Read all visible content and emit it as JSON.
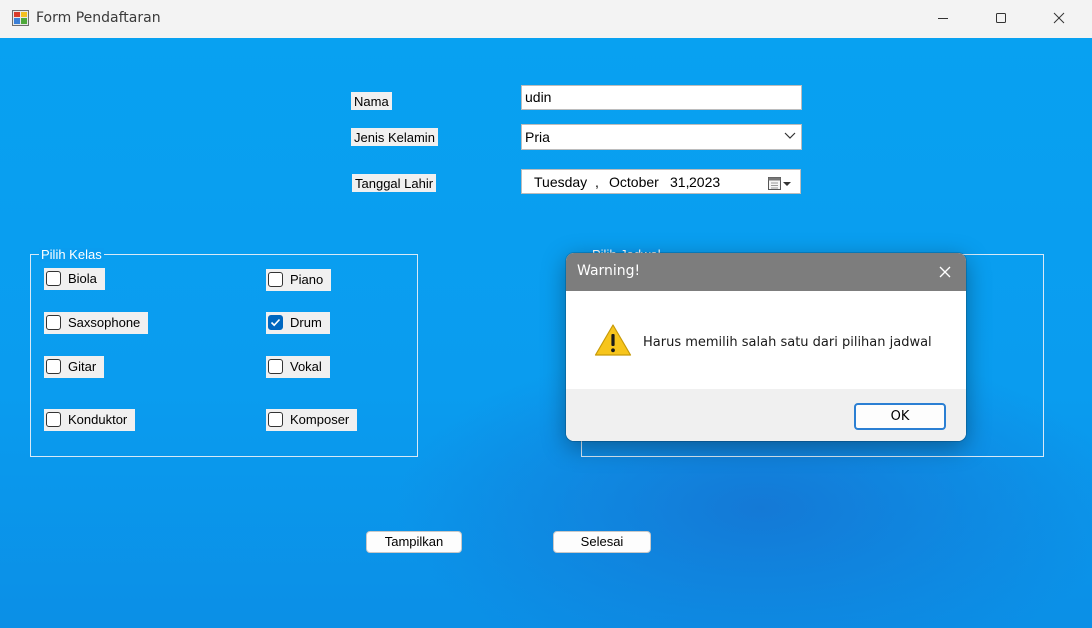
{
  "window": {
    "title": "Form Pendaftaran",
    "icon": "form-app-icon"
  },
  "form": {
    "nama_label": "Nama",
    "nama_value": "udin",
    "jenis_kelamin_label": "Jenis Kelamin",
    "jenis_kelamin_value": "Pria",
    "tanggal_lahir_label": "Tanggal Lahir",
    "tanggal_lahir": {
      "day_name": "Tuesday",
      "sep": ",",
      "month": "October",
      "day": "31,",
      "year": "2023"
    }
  },
  "pilih_kelas": {
    "caption": "Pilih Kelas",
    "options": [
      {
        "label": "Biola",
        "checked": false
      },
      {
        "label": "Piano",
        "checked": false
      },
      {
        "label": "Saxsophone",
        "checked": false
      },
      {
        "label": "Drum",
        "checked": true
      },
      {
        "label": "Gitar",
        "checked": false
      },
      {
        "label": "Vokal",
        "checked": false
      },
      {
        "label": "Konduktor",
        "checked": false
      },
      {
        "label": "Komposer",
        "checked": false
      }
    ]
  },
  "pilih_jadwal": {
    "caption": "Pilih Jadwal"
  },
  "buttons": {
    "tampilkan": "Tampilkan",
    "selesai": "Selesai"
  },
  "dialog": {
    "title": "Warning!",
    "message": "Harus memilih salah satu dari pilihan jadwal",
    "ok": "OK",
    "icon": "warning-icon"
  },
  "colors": {
    "client_background": "#0a9cef",
    "accent": "#0067c0",
    "dialog_title_bar": "#7d7d7d"
  }
}
